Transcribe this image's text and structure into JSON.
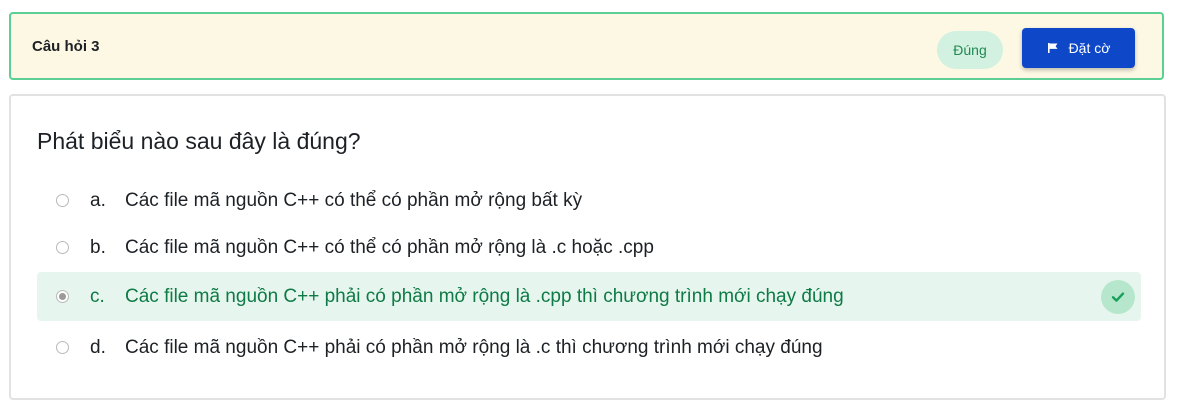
{
  "question": {
    "title": "Câu hỏi 3",
    "status": "Đúng",
    "flag_label": "Đặt cờ",
    "text": "Phát biểu nào sau đây là đúng?",
    "answers": [
      {
        "letter": "a.",
        "text": "Các file mã nguồn C++ có thể có phần mở rộng bất kỳ",
        "selected": false,
        "correct": false
      },
      {
        "letter": "b.",
        "text": "Các file mã nguồn C++ có thể có phần mở rộng là .c hoặc .cpp",
        "selected": false,
        "correct": false
      },
      {
        "letter": "c.",
        "text": "Các file mã nguồn C++ phải có phần mở rộng là .cpp thì chương trình mới chạy đúng",
        "selected": true,
        "correct": true
      },
      {
        "letter": "d.",
        "text": "Các file mã nguồn C++ phải có phần mở rộng là .c thì chương trình mới chạy đúng",
        "selected": false,
        "correct": false
      }
    ]
  },
  "colors": {
    "header_bg": "#fcf8e3",
    "header_border": "#5ccf94",
    "flag_button_bg": "#0f47c9",
    "correct_bg": "#e6f6ee",
    "correct_text": "#0e7a45"
  },
  "icons": {
    "flag": "flag-icon",
    "correct": "check-icon"
  }
}
